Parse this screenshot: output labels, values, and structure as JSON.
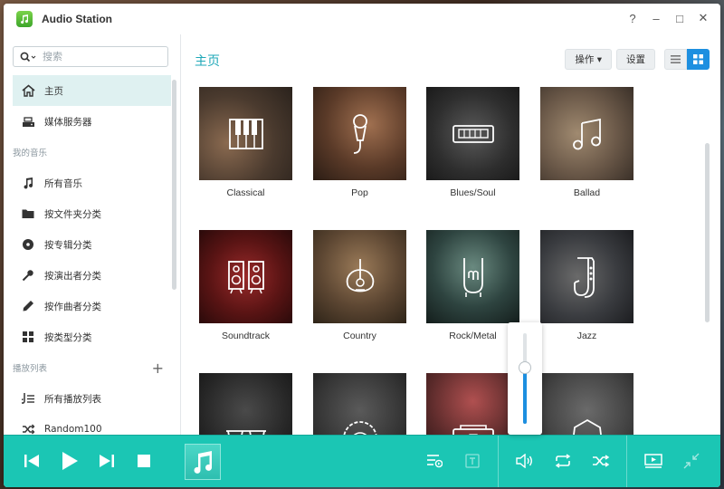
{
  "window": {
    "title": "Audio Station"
  },
  "titlebar_controls": [
    "?",
    "–",
    "□",
    "✕"
  ],
  "search": {
    "placeholder": "搜索"
  },
  "sidebar": {
    "top_items": [
      {
        "label": "主页",
        "icon": "home-icon",
        "active": true
      },
      {
        "label": "媒体服务器",
        "icon": "media-server-icon"
      }
    ],
    "my_music_header": "我的音乐",
    "my_music_items": [
      {
        "label": "所有音乐",
        "icon": "music-note-icon"
      },
      {
        "label": "按文件夹分类",
        "icon": "folder-icon"
      },
      {
        "label": "按专辑分类",
        "icon": "disc-icon"
      },
      {
        "label": "按演出者分类",
        "icon": "microphone-icon"
      },
      {
        "label": "按作曲者分类",
        "icon": "pen-icon"
      },
      {
        "label": "按类型分类",
        "icon": "grid-icon"
      }
    ],
    "playlist_header": "播放列表",
    "playlist_add": "+",
    "playlist_items": [
      {
        "label": "所有播放列表",
        "icon": "playlist-icon"
      },
      {
        "label": "Random100",
        "icon": "shuffle-icon"
      }
    ]
  },
  "main": {
    "title": "主页",
    "actions_label": "操作 ▾",
    "settings_label": "设置"
  },
  "genres": [
    {
      "label": "Classical",
      "icon": "piano-icon",
      "bg": "#5a4a3c"
    },
    {
      "label": "Pop",
      "icon": "microphone-icon",
      "bg": "#6b4a35"
    },
    {
      "label": "Blues/Soul",
      "icon": "keyboard-icon",
      "bg": "#3a3a3a"
    },
    {
      "label": "Ballad",
      "icon": "music-note-icon",
      "bg": "#7a6a5a"
    },
    {
      "label": "Soundtrack",
      "icon": "speakers-icon",
      "bg": "#5a1a1a"
    },
    {
      "label": "Country",
      "icon": "guitar-icon",
      "bg": "#5c4a36"
    },
    {
      "label": "Rock/Metal",
      "icon": "rock-hand-icon",
      "bg": "#3a4a45"
    },
    {
      "label": "Jazz",
      "icon": "saxophone-icon",
      "bg": "#3a3c40"
    },
    {
      "label": "",
      "icon": "sunglasses-icon",
      "bg": "#2a2a2a"
    },
    {
      "label": "",
      "icon": "afro-icon",
      "bg": "#3a3a3a"
    },
    {
      "label": "",
      "icon": "boombox-icon",
      "bg": "#5a2a2a"
    },
    {
      "label": "",
      "icon": "lion-icon",
      "bg": "#454545"
    }
  ],
  "volume": {
    "level": 0.62
  },
  "player": {
    "accent": "#1bc6b4",
    "controls": [
      "previous-icon",
      "play-icon",
      "next-icon",
      "stop-icon"
    ],
    "right_controls": [
      "queue-icon",
      "lyrics-icon",
      "volume-icon",
      "repeat-icon",
      "shuffle-icon",
      "mini-player-icon",
      "collapse-icon"
    ]
  }
}
